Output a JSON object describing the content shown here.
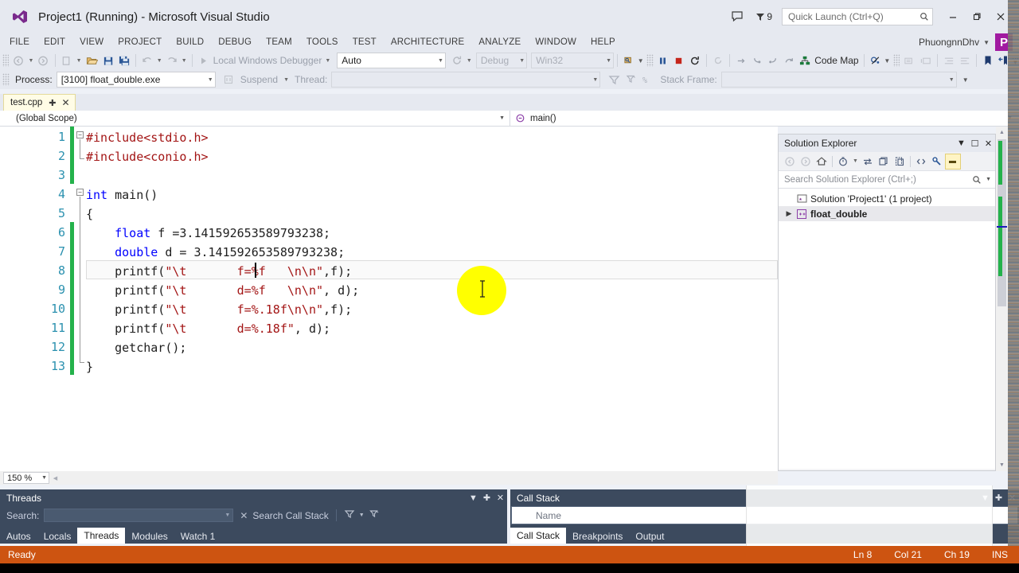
{
  "window": {
    "title": "Project1 (Running) - Microsoft Visual Studio",
    "logo_icon": "visual-studio-logo",
    "minimize_label": "–",
    "restore_label": "❐",
    "close_label": "✕",
    "feedback_icon": "feedback-balloon-icon",
    "notification_icon": "notification-flag-icon",
    "notification_count": "9"
  },
  "quick_launch": {
    "placeholder": "Quick Launch (Ctrl+Q)",
    "search_icon": "search-icon"
  },
  "menu": {
    "items": [
      {
        "label": "FILE"
      },
      {
        "label": "EDIT"
      },
      {
        "label": "VIEW"
      },
      {
        "label": "PROJECT"
      },
      {
        "label": "BUILD"
      },
      {
        "label": "DEBUG"
      },
      {
        "label": "TEAM"
      },
      {
        "label": "TOOLS"
      },
      {
        "label": "TEST"
      },
      {
        "label": "ARCHITECTURE"
      },
      {
        "label": "ANALYZE"
      },
      {
        "label": "WINDOW"
      },
      {
        "label": "HELP"
      }
    ],
    "user_name": "PhuongnnDhv",
    "user_initial": "P"
  },
  "toolbar": {
    "navigate_back_icon": "navigate-back-icon",
    "navigate_forward_icon": "navigate-forward-icon",
    "new_project_icon": "new-project-icon",
    "open_file_icon": "open-file-icon",
    "save_icon": "save-icon",
    "save_all_icon": "save-all-icon",
    "undo_icon": "undo-icon",
    "redo_icon": "redo-icon",
    "start_debug_icon": "play-icon",
    "start_debug_label": "Local Windows Debugger",
    "platform_value": "Auto",
    "refresh_icon": "refresh-icon",
    "config_value": "Debug",
    "platform2_value": "Win32",
    "attach_icon": "attach-process-icon",
    "pause_icon": "pause-icon",
    "stop_icon": "stop-icon",
    "restart_icon": "restart-icon",
    "hot_reload_icon": "hot-reload-icon",
    "step_over_icon": "step-over-icon",
    "step_into_icon": "step-into-icon",
    "step_out_icon": "step-out-icon",
    "step_back_icon": "step-back-icon",
    "code_map_icon": "code-map-icon",
    "code_map_label": "Code Map",
    "breakpoint_icon": "breakpoint-toggle-icon",
    "comment_icon": "comment-icon",
    "uncomment_icon": "uncomment-icon",
    "indent_icon": "indent-icon",
    "outdent_icon": "outdent-icon",
    "bookmark_icon": "bookmark-icon",
    "bookmark_next_icon": "bookmark-next-icon",
    "overflow_icon": "toolbar-overflow-icon"
  },
  "debug_bar": {
    "process_label": "Process:",
    "process_value": "[3100] float_double.exe",
    "suspend_label": "Suspend",
    "suspend_icon": "suspend-icon",
    "thread_label": "Thread:",
    "thread_value": "",
    "stack_frame_label": "Stack Frame:",
    "stack_frame_value": "",
    "filter_icon": "filter-icon",
    "flag_icon": "flag-threads-icon",
    "xx_icon": "unflag-icon"
  },
  "document_tab": {
    "name": "test.cpp",
    "pin_icon": "pin-icon",
    "close_icon": "close-icon"
  },
  "scope_bar": {
    "scope_value": "(Global Scope)",
    "member_icon": "method-icon",
    "member_value": "main()"
  },
  "editor": {
    "zoom_level": "150 %",
    "lines": [
      {
        "num": "1",
        "text": "#include<stdio.h>",
        "changed": true,
        "fold": "collapse"
      },
      {
        "num": "2",
        "text": "#include<conio.h>",
        "changed": true,
        "fold": "end"
      },
      {
        "num": "3",
        "text": "",
        "changed": true,
        "fold": ""
      },
      {
        "num": "4",
        "text": "int main()",
        "changed": false,
        "fold": "collapse"
      },
      {
        "num": "5",
        "text": "{",
        "changed": false,
        "fold": ""
      },
      {
        "num": "6",
        "text": "    float f =3.141592653589793238;",
        "changed": true,
        "fold": ""
      },
      {
        "num": "7",
        "text": "    double d = 3.141592653589793238;",
        "changed": true,
        "fold": ""
      },
      {
        "num": "8",
        "text": "    printf(\"\\t       f=%f   \\n\\n\",f);",
        "changed": true,
        "fold": ""
      },
      {
        "num": "9",
        "text": "    printf(\"\\t       d=%f   \\n\\n\", d);",
        "changed": true,
        "fold": ""
      },
      {
        "num": "10",
        "text": "    printf(\"\\t       f=%.18f\\n\\n\",f);",
        "changed": true,
        "fold": ""
      },
      {
        "num": "11",
        "text": "    printf(\"\\t       d=%.18f\", d);",
        "changed": true,
        "fold": ""
      },
      {
        "num": "12",
        "text": "    getchar();",
        "changed": true,
        "fold": ""
      },
      {
        "num": "13",
        "text": "}",
        "changed": true,
        "fold": "end"
      }
    ],
    "current_line": 8,
    "cursor_icon": "text-ibeam-cursor",
    "highlight_color": "#ffff00"
  },
  "solution_explorer": {
    "title": "Solution Explorer",
    "dropdown_icon": "chevron-down-icon",
    "maximize_icon": "maximize-icon",
    "close_icon": "close-icon",
    "toolbar_icons": [
      "back-icon",
      "forward-icon",
      "home-icon",
      "pending-changes-icon",
      "sync-icon",
      "refresh-view-icon",
      "collapse-all-icon",
      "show-all-files-icon",
      "code-view-icon",
      "properties-icon",
      "preview-selected-icon"
    ],
    "search_placeholder": "Search Solution Explorer (Ctrl+;)",
    "search_icon": "search-icon",
    "tree": [
      {
        "label": "Solution 'Project1' (1 project)",
        "icon": "solution-icon",
        "expander": "",
        "bold": false,
        "selected": false
      },
      {
        "label": "float_double",
        "icon": "cpp-project-icon",
        "expander": "▶",
        "bold": true,
        "selected": true
      }
    ]
  },
  "threads_panel": {
    "title": "Threads",
    "dropdown_icon": "chevron-down-icon",
    "pin_icon": "pin-icon",
    "close_icon": "close-icon",
    "search_label": "Search:",
    "search_value": "",
    "clear_icon": "clear-x-icon",
    "search_call_stack_label": "Search Call Stack",
    "filter_icon": "filter-icon",
    "flag_filter_icon": "flag-filter-icon",
    "tabs": [
      {
        "label": "Autos",
        "active": false
      },
      {
        "label": "Locals",
        "active": false
      },
      {
        "label": "Threads",
        "active": true
      },
      {
        "label": "Modules",
        "active": false
      },
      {
        "label": "Watch 1",
        "active": false
      }
    ]
  },
  "call_stack_panel": {
    "title": "Call Stack",
    "column_name": "Name",
    "pin_icon": "pin-icon",
    "close_icon": "close-icon",
    "tabs": [
      {
        "label": "Call Stack",
        "active": true
      },
      {
        "label": "Breakpoints",
        "active": false
      },
      {
        "label": "Output",
        "active": false
      }
    ]
  },
  "status_bar": {
    "status": "Ready",
    "line": "Ln 8",
    "col": "Col 21",
    "ch": "Ch 19",
    "insert_mode": "INS",
    "background": "#cd5411"
  }
}
